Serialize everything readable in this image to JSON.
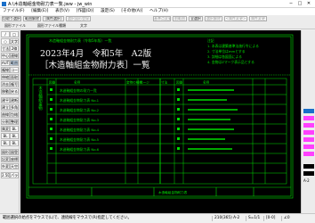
{
  "window": {
    "title": "A:\\木造軸組金物耐力表一覧.jww - jw_win",
    "minimize": "─",
    "maximize": "□",
    "close": "✕"
  },
  "menu": [
    "ファイル(F)",
    "[編集(E)]",
    "表示(V)",
    "[作図(D)]",
    "設定(S)",
    "[その他(A)]",
    "ヘルプ(H)"
  ],
  "toolbar1": {
    "left": [
      {
        "label": "切取り選択",
        "enabled": true
      },
      {
        "label": "範囲解除",
        "enabled": true
      },
      {
        "label": "[属性選択]",
        "enabled": true
      },
      {
        "label": "選択図形登録",
        "enabled": false
      }
    ],
    "right": [
      {
        "label": "基準点変更",
        "enabled": false
      },
      {
        "label": "前範囲",
        "enabled": false
      },
      {
        "label": "全選択",
        "enabled": true
      },
      {
        "label": "選択解除",
        "enabled": false
      },
      {
        "label": "<属性変更>",
        "enabled": false
      },
      {
        "label": "属性変更",
        "enabled": false
      }
    ]
  },
  "toolbar2": [
    "図形ファイル",
    "図形ファイル種類",
    "文字"
  ],
  "left_tools": [
    [
      "/",
      "□"
    ],
    [
      "○",
      "文字"
    ],
    [
      "寸法",
      "2線"
    ],
    [
      "中心線",
      "連線"
    ],
    [
      "AUTO",
      "範囲"
    ],
    [
      "複線",
      "コーナー"
    ],
    [
      "伸縮",
      "面取"
    ],
    [
      "消去",
      "複写"
    ],
    [
      "移動",
      "戻る"
    ],
    [
      "建平",
      "建断"
    ],
    [
      "建立",
      "多角形"
    ],
    [
      "曲線",
      "包絡"
    ],
    [
      "分割",
      "整理"
    ],
    [
      "属変",
      "BL化"
    ],
    [
      "BL解",
      "BL属"
    ],
    [
      "BL編",
      "BL終"
    ],
    [
      "図形",
      "図登"
    ],
    [
      "記変",
      "座標"
    ],
    [
      "外変",
      "天空"
    ],
    [
      "2.5D",
      "パラメ"
    ]
  ],
  "right_panel": {
    "labels": [
      "0",
      "1",
      "2",
      "3",
      "4",
      "5"
    ],
    "status": "A-2"
  },
  "drawing": {
    "heading_date": "2023年4月　令和5年　A2版",
    "heading_title": "［木造軸組金物耐力表］一覧",
    "small_header": "木造軸組金物耐力表（令和5年版）一覧",
    "col_headers": [
      "図番",
      "名称",
      "金物の種類",
      "ページ",
      "寸法",
      "図番",
      "名称"
    ],
    "side_text": "木造軸組金物",
    "rows": [
      "木造軸組金物の耐力一覧",
      "木造軸組金物耐力表 No.1",
      "木造軸組金物耐力表 No.2",
      "木造軸組金物耐力表 No.3",
      "木造軸組金物耐力表 No.4",
      "木造軸組金物耐力表 No.5",
      "木造軸組金物耐力表 No.6"
    ],
    "note_lines": [
      "注記",
      "1. 本表は建築基準法施行令による",
      "2. 寸法単位はmmとする",
      "3. 詳細は各図面による",
      "4. 金物はZマーク表示品とする"
    ],
    "footer": "木造軸組金物耐力表"
  },
  "status": {
    "message": "範囲選択の始点をマウスで(L)で、連続線をマウスで(R)指定してください。",
    "scale": "∠0",
    "size": "S=1/1",
    "zoom": "[S=1]表示",
    "layer": "[0-0]",
    "group": "A-2",
    "coords": "210(365) A-2"
  },
  "colors": {
    "canvas_bg": "#000000",
    "drawing_line": "#00e000",
    "text_white": "#f2f2f2",
    "magenta": "#ff40ff",
    "selected_blue": "#1a6fc9"
  }
}
